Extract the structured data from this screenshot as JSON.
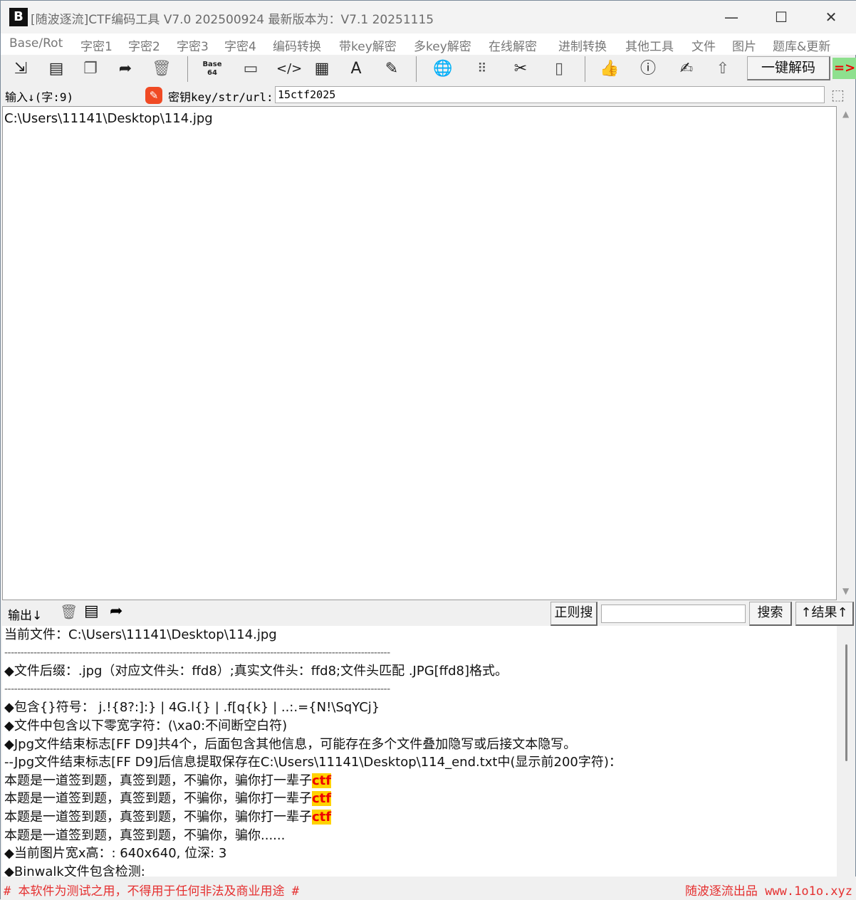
{
  "window": {
    "logo": "B",
    "title": "[随波逐流]CTF编码工具 V7.0 202500924    最新版本为：V7.1  20251115",
    "minimize": "—",
    "maximize": "☐",
    "close": "✕"
  },
  "menu": [
    "Base/Rot",
    "字密1",
    "字密2",
    "字密3",
    "字密4",
    "编码转换",
    "带key解密",
    "多key解密",
    "在线解密",
    "进制转换",
    "其他工具",
    "文件",
    "图片",
    "题库&更新"
  ],
  "toolbar": {
    "decode_button": "一键解码",
    "arrow": "=>"
  },
  "keyrow": {
    "input_label": "输入↓(字:9)",
    "key_label": "密钥key/str/url:",
    "key_value": "15ctf2025"
  },
  "input": {
    "text": "C:\\Users\\11141\\Desktop\\114.jpg"
  },
  "output_bar": {
    "label": "输出↓",
    "regex_button": "正则搜",
    "search_value": "",
    "search_button": "搜索",
    "result_button": "↑结果↑"
  },
  "output": {
    "lines": [
      "当前文件：C:\\Users\\11141\\Desktop\\114.jpg",
      "-----------------------------------------------------------------------------------------------------------------------",
      "◆文件后缀：.jpg（对应文件头：ffd8）;真实文件头：ffd8;文件头匹配 .JPG[ffd8]格式。",
      "-----------------------------------------------------------------------------------------------------------------------",
      "◆包含{}符号： j.!{8?:]:} | 4G.l{} | .f[q{k} | ..:.={N!\\SqYCj}",
      "◆文件中包含以下零宽字符：(\\xa0:不间断空白符)",
      "◆Jpg文件结束标志[FF D9]共4个，后面包含其他信息，可能存在多个文件叠加隐写或后接文本隐写。",
      "--Jpg文件结束标志[FF D9]后信息提取保存在C:\\Users\\11141\\Desktop\\114_end.txt中(显示前200字符)："
    ],
    "hl_lines": [
      "本题是一道签到题，真签到题，不骗你，骗你打一辈子",
      "本题是一道签到题，真签到题，不骗你，骗你打一辈子",
      "本题是一道签到题，真签到题，不骗你，骗你打一辈子"
    ],
    "hl_word": "ctf",
    "tail": [
      "本题是一道签到题，真签到题，不骗你，骗你......",
      "◆当前图片宽x高：: 640x640, 位深: 3",
      "◆Binwalk文件包含检测:"
    ]
  },
  "footer": {
    "left": "# 本软件为测试之用，不得用于任何非法及商业用途 #",
    "right": "随波逐流出品 www.1o1o.xyz"
  }
}
